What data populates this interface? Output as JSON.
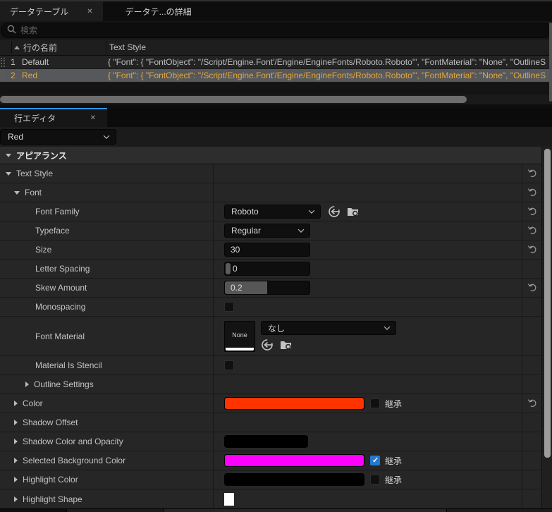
{
  "icons": {
    "close": "✕"
  },
  "data_table_panel": {
    "tabs": [
      {
        "label": "データテーブル"
      },
      {
        "label": "データテ...の詳細"
      }
    ],
    "search_placeholder": "検索",
    "columns": {
      "row_name": "行の名前",
      "text_style": "Text Style"
    },
    "rows": [
      {
        "num": "1",
        "name": "Default",
        "value": "{ \"Font\": { \"FontObject\": \"/Script/Engine.Font'/Engine/EngineFonts/Roboto.Roboto'\", \"FontMaterial\": \"None\", \"OutlineS",
        "selected": false
      },
      {
        "num": "2",
        "name": "Red",
        "value": "{ \"Font\": { \"FontObject\": \"/Script/Engine.Font'/Engine/EngineFonts/Roboto.Roboto'\", \"FontMaterial\": \"None\", \"OutlineS",
        "selected": true
      }
    ]
  },
  "row_editor": {
    "tab_label": "行エディタ",
    "selected_row": "Red",
    "category": "アピアランス",
    "props": {
      "text_style": {
        "label": "Text Style"
      },
      "font": {
        "label": "Font"
      },
      "font_family": {
        "label": "Font Family",
        "value": "Roboto"
      },
      "typeface": {
        "label": "Typeface",
        "value": "Regular"
      },
      "size": {
        "label": "Size",
        "value": "30"
      },
      "letter_spacing": {
        "label": "Letter Spacing",
        "value": "0"
      },
      "skew_amount": {
        "label": "Skew Amount",
        "value": "0.2"
      },
      "monospacing": {
        "label": "Monospacing",
        "checked": false
      },
      "font_material": {
        "label": "Font Material",
        "thumb": "None",
        "value": "なし"
      },
      "material_is_stencil": {
        "label": "Material Is Stencil",
        "checked": false
      },
      "outline_settings": {
        "label": "Outline Settings"
      },
      "color": {
        "label": "Color",
        "value_hex": "#ff3300",
        "inherit": "継承",
        "inherit_checked": false
      },
      "shadow_offset": {
        "label": "Shadow Offset"
      },
      "shadow_color": {
        "label": "Shadow Color and Opacity",
        "value_hex": "#000000"
      },
      "selected_bg": {
        "label": "Selected Background Color",
        "value_hex": "#ff00ff",
        "inherit": "継承",
        "inherit_checked": true
      },
      "highlight_color": {
        "label": "Highlight Color",
        "value_hex": "#000000",
        "inherit": "継承",
        "inherit_checked": false
      },
      "highlight_shape": {
        "label": "Highlight Shape",
        "value_hex": "#ffffff"
      }
    }
  }
}
